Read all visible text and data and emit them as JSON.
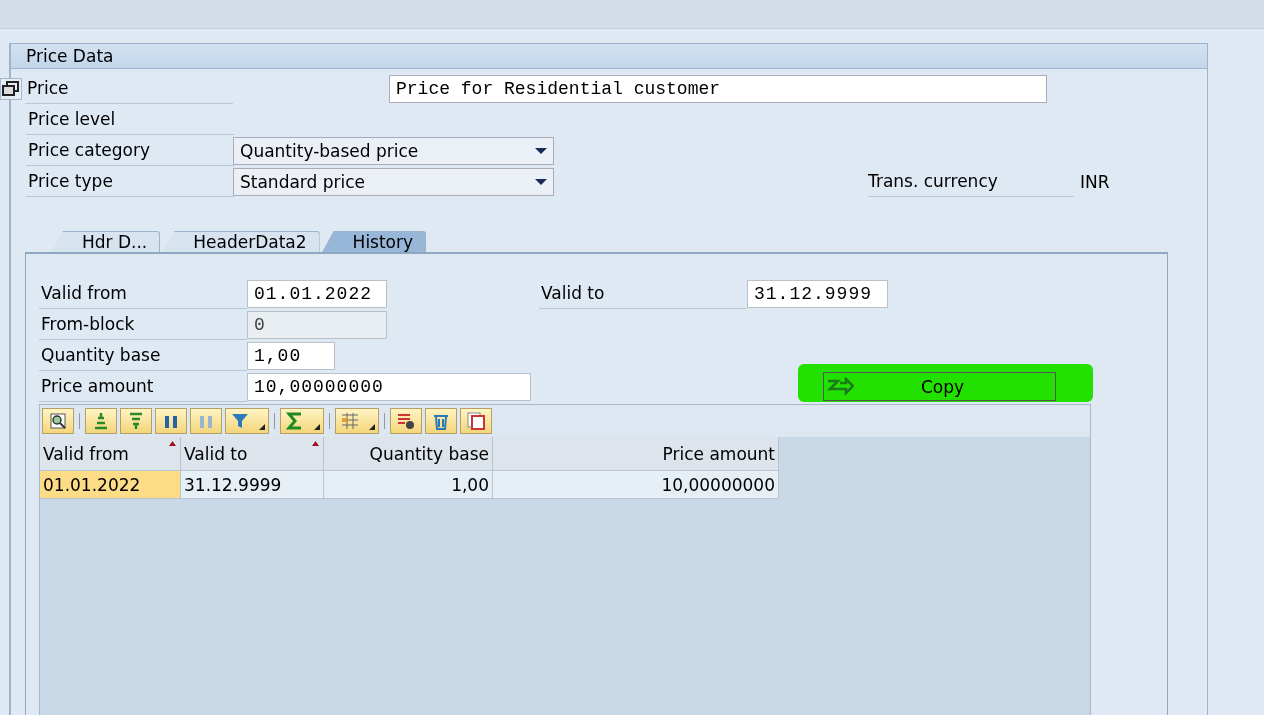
{
  "panel": {
    "title": "Price Data"
  },
  "header_fields": [
    {
      "label": "Price",
      "kind": "text",
      "value": "Price for Residential customer"
    },
    {
      "label": "Price level",
      "kind": "none"
    },
    {
      "label": "Price category",
      "kind": "dropdown",
      "value": "Quantity-based price"
    },
    {
      "label": "Price type",
      "kind": "dropdown",
      "value": "Standard price"
    }
  ],
  "currency": {
    "label": "Trans. currency",
    "value": "INR"
  },
  "tabs": [
    {
      "label": "Hdr D...",
      "selected": false
    },
    {
      "label": "HeaderData2",
      "selected": false
    },
    {
      "label": "History",
      "selected": true
    }
  ],
  "history_fields": [
    {
      "label": "Valid from",
      "value": "01.01.2022",
      "kind": "input"
    },
    {
      "label": "From-block",
      "value": "0",
      "kind": "readonly"
    },
    {
      "label": "Quantity base",
      "value": "1,00",
      "kind": "input"
    },
    {
      "label": "Price amount",
      "value": "10,00000000",
      "kind": "input"
    }
  ],
  "valid_to": {
    "label": "Valid to",
    "value": "31.12.9999"
  },
  "copy_button": {
    "label": "Copy",
    "highlighted": true
  },
  "toolbar": [
    {
      "kind": "details"
    },
    {
      "kind": "top"
    },
    {
      "kind": "bottom"
    },
    {
      "kind": "find"
    },
    {
      "kind": "find-next"
    },
    {
      "kind": "filter"
    },
    {
      "kind": "sum"
    },
    {
      "kind": "layout"
    },
    {
      "kind": "delete-row"
    },
    {
      "kind": "trash"
    },
    {
      "kind": "export"
    }
  ],
  "table": {
    "columns": [
      {
        "label": "Valid from",
        "kind": "date",
        "sorted": true
      },
      {
        "label": "Valid to",
        "kind": "date",
        "sorted": true
      },
      {
        "label": "Quantity base",
        "kind": "number",
        "sorted": false
      },
      {
        "label": "Price amount",
        "kind": "number",
        "sorted": false
      }
    ],
    "rows": [
      {
        "cells": [
          {
            "text": "01.01.2022",
            "selected": true
          },
          {
            "text": "31.12.9999",
            "selected": false
          },
          {
            "text": "1,00",
            "selected": false
          },
          {
            "text": "10,00000000",
            "selected": false
          }
        ]
      }
    ]
  }
}
